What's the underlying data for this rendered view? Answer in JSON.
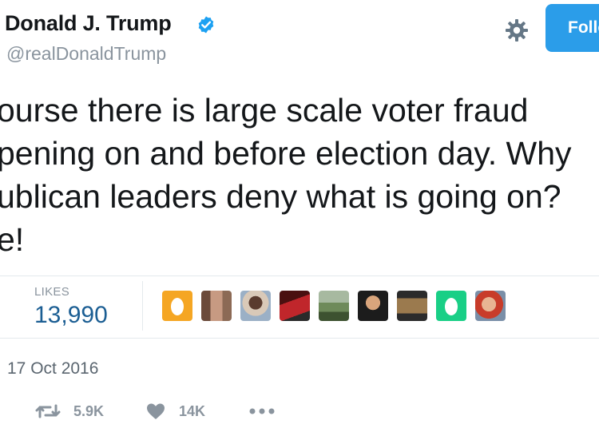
{
  "header": {
    "display_name": "Donald J. Trump",
    "handle": "@realDonaldTrump",
    "follow_label": "Follow"
  },
  "tweet": {
    "lines": [
      "ourse there is large scale voter fraud",
      "pening on and before election day. Why",
      "ublican leaders deny what is going on?",
      "e!"
    ]
  },
  "stats": {
    "likes_label": "LIKES",
    "likes_count": "13,990"
  },
  "liker_avatars": [
    "egg-avatar",
    "photo-avatar",
    "photo-avatar",
    "photo-avatar",
    "photo-avatar",
    "photo-avatar",
    "photo-avatar",
    "egg-avatar",
    "photo-avatar"
  ],
  "meta": {
    "date": "17 Oct 2016"
  },
  "actions": {
    "retweets": "5.9K",
    "likes": "14K"
  },
  "colors": {
    "accent": "#2b9de9",
    "verified": "#1da1f2",
    "likes_count": "#1b5e93",
    "muted": "#8a949e",
    "egg_orange": "#f5a623",
    "egg_green": "#19cf86"
  },
  "icons": [
    "verified-badge-icon",
    "gear-icon",
    "retweet-icon",
    "heart-icon",
    "more-icon"
  ]
}
